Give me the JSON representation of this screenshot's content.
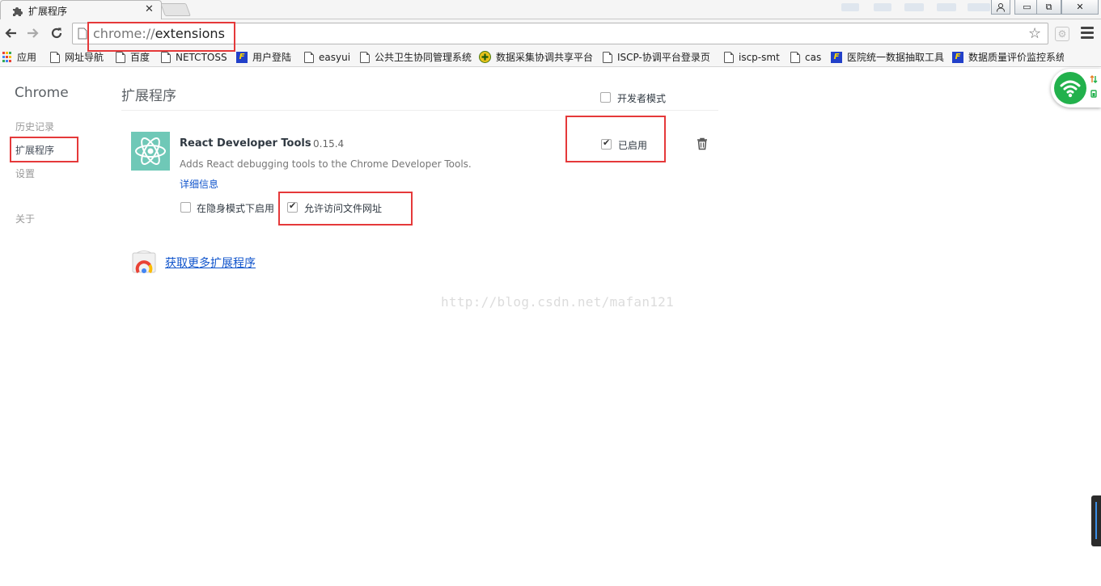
{
  "tab": {
    "title": "扩展程序",
    "close": "✕",
    "favicon": "puzzle-icon"
  },
  "window": {
    "minimize": "▭",
    "restore": "⧉",
    "close": "✕"
  },
  "address_bar": {
    "scheme": "chrome://",
    "path": "extensions"
  },
  "bookmarks": [
    {
      "label": "应用",
      "icon": "apps-grid-icon"
    },
    {
      "label": "网址导航",
      "icon": "page-icon"
    },
    {
      "label": "百度",
      "icon": "page-icon"
    },
    {
      "label": "NETCTOSS",
      "icon": "page-icon"
    },
    {
      "label": "用户登陆",
      "icon": "f-brand-icon"
    },
    {
      "label": "easyui",
      "icon": "page-icon"
    },
    {
      "label": "公共卫生协同管理系统",
      "icon": "page-icon"
    },
    {
      "label": "数据采集协调共享平台",
      "icon": "plus-circle-icon"
    },
    {
      "label": "ISCP-协调平台登录页",
      "icon": "page-icon"
    },
    {
      "label": "iscp-smt",
      "icon": "page-icon"
    },
    {
      "label": "cas",
      "icon": "page-icon"
    },
    {
      "label": "医院统一数据抽取工具",
      "icon": "f-brand-icon"
    },
    {
      "label": "数据质量评价监控系统",
      "icon": "f-brand-icon"
    }
  ],
  "sidebar": {
    "title": "Chrome",
    "items": [
      {
        "label": "历史记录"
      },
      {
        "label": "扩展程序",
        "active": true
      },
      {
        "label": "设置"
      },
      {
        "label": "关于"
      }
    ]
  },
  "main": {
    "title": "扩展程序",
    "developer_mode": {
      "label": "开发者模式",
      "checked": false
    },
    "extension": {
      "name": "React Developer Tools",
      "version": "0.15.4",
      "description": "Adds React debugging tools to the Chrome Developer Tools.",
      "details_link": "详细信息",
      "enabled": {
        "label": "已启用",
        "checked": true
      },
      "incognito": {
        "label": "在隐身模式下启用",
        "checked": false
      },
      "file_access": {
        "label": "允许访问文件网址",
        "checked": true
      }
    },
    "get_more": "获取更多扩展程序"
  },
  "watermark": "http://blog.csdn.net/mafan121",
  "colors": {
    "accent_link": "#1155cc",
    "annotation_red": "#e5393a",
    "react_teal": "#6fc8b7",
    "wifi_green": "#22b14c"
  }
}
